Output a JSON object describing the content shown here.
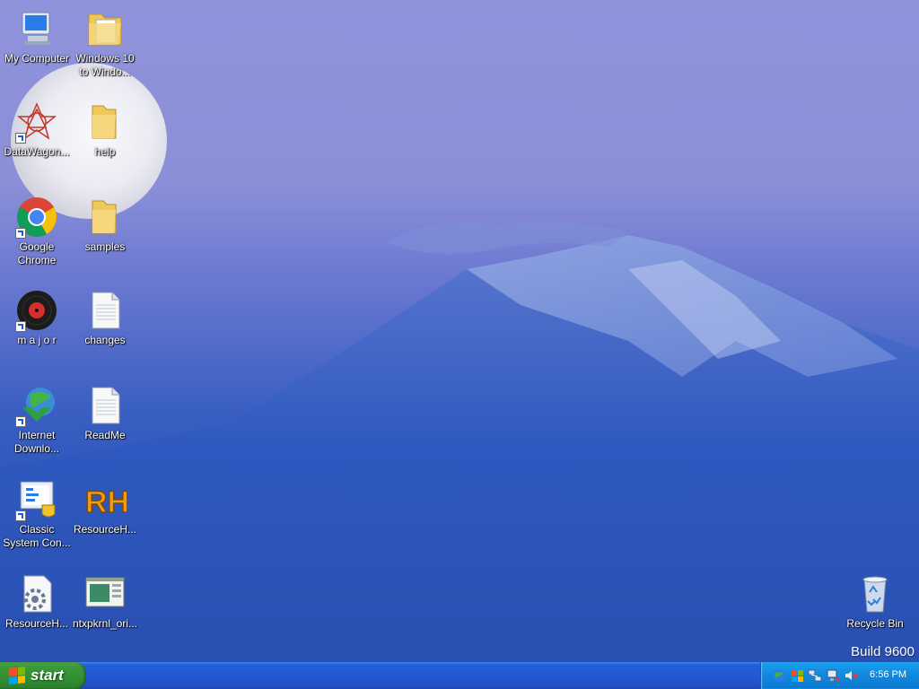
{
  "desktop": {
    "build_text": "Build 9600",
    "icons": [
      {
        "label": "My Computer"
      },
      {
        "label": "Windows 10\nto Windo..."
      },
      {
        "label": "DataWagon..."
      },
      {
        "label": "help"
      },
      {
        "label": "Google\nChrome"
      },
      {
        "label": "samples"
      },
      {
        "label": "m a j o r"
      },
      {
        "label": "changes"
      },
      {
        "label": "Internet\nDownlo..."
      },
      {
        "label": "ReadMe"
      },
      {
        "label": "Classic\nSystem Con..."
      },
      {
        "label": "ResourceH..."
      },
      {
        "label": "ResourceH..."
      },
      {
        "label": "ntxpkrnl_ori..."
      },
      {
        "label": "Recycle Bin"
      }
    ],
    "rh_text": "RH"
  },
  "taskbar": {
    "start_label": "start",
    "clock": "6:56 PM"
  },
  "colors": {
    "taskbar_blue": "#245edb",
    "start_green": "#3c9a3c",
    "tray_blue": "#0f88de"
  }
}
